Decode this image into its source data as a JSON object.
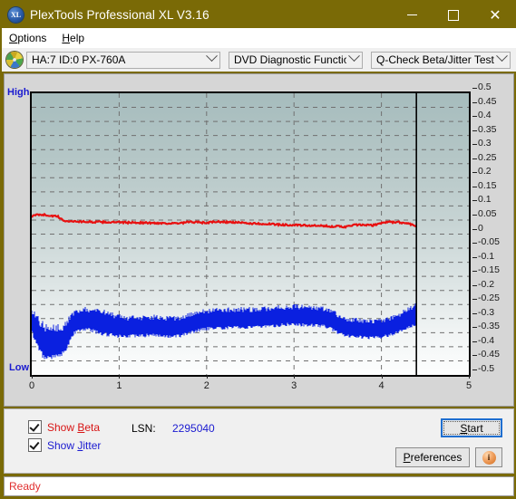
{
  "window": {
    "title": "PlexTools Professional XL V3.16",
    "icon": "xl-logo-icon",
    "minimize": "minimize-icon",
    "maximize": "maximize-icon",
    "close": "close-icon"
  },
  "menu": {
    "items": [
      {
        "label": "Options",
        "accel": "O"
      },
      {
        "label": "Help",
        "accel": "H"
      }
    ]
  },
  "toolbar": {
    "drive_icon": "optical-disc-icon",
    "drive_select": {
      "value": "HA:7 ID:0  PX-760A"
    },
    "function_select": {
      "value": "DVD Diagnostic Functions"
    },
    "test_select": {
      "value": "Q-Check Beta/Jitter Test"
    }
  },
  "chart_labels": {
    "high": "High",
    "low": "Low"
  },
  "controls": {
    "show_beta": {
      "label": "Show Beta",
      "accel": "B",
      "checked": true,
      "color": "#d81515"
    },
    "show_jitter": {
      "label": "Show Jitter",
      "accel": "J",
      "checked": true,
      "color": "#1a1ad0"
    },
    "lsn_label": "LSN:",
    "lsn_value": "2295040",
    "start_button": {
      "label": "Start",
      "accel": "S"
    },
    "preferences_button": {
      "label": "Preferences",
      "accel": "P"
    },
    "info_button": {
      "icon": "info-icon"
    }
  },
  "status": {
    "text": "Ready"
  },
  "chart_data": {
    "type": "line",
    "title": "Q-Check Beta/Jitter Test",
    "xlabel": "",
    "ylabel": "",
    "xlim": [
      0,
      5
    ],
    "ylim": [
      -0.5,
      0.5
    ],
    "xticks": [
      0,
      1,
      2,
      3,
      4,
      5
    ],
    "yticks": [
      0.5,
      0.45,
      0.4,
      0.35,
      0.3,
      0.25,
      0.2,
      0.15,
      0.1,
      0.05,
      0,
      -0.05,
      -0.1,
      -0.15,
      -0.2,
      -0.25,
      -0.3,
      -0.35,
      -0.4,
      -0.45,
      -0.5
    ],
    "grid": true,
    "grid_style": "dashed",
    "legend": [
      "Show Beta",
      "Show Jitter"
    ],
    "annotations": [
      {
        "type": "vline",
        "x": 4.4,
        "color": "#000000",
        "label": "scan-end-marker"
      }
    ],
    "data_end_x": 4.4,
    "series": [
      {
        "name": "Beta",
        "color": "#e81010",
        "type": "line",
        "x": [
          0.0,
          0.05,
          0.1,
          0.15,
          0.2,
          0.25,
          0.3,
          0.35,
          0.4,
          0.5,
          0.6,
          0.7,
          0.8,
          0.9,
          1.0,
          1.1,
          1.2,
          1.3,
          1.4,
          1.5,
          1.6,
          1.7,
          1.8,
          1.9,
          2.0,
          2.1,
          2.2,
          2.3,
          2.4,
          2.5,
          2.6,
          2.7,
          2.8,
          2.9,
          3.0,
          3.1,
          3.2,
          3.3,
          3.4,
          3.5,
          3.6,
          3.7,
          3.8,
          3.9,
          4.0,
          4.1,
          4.2,
          4.3,
          4.4
        ],
        "y": [
          0.062,
          0.068,
          0.07,
          0.068,
          0.066,
          0.064,
          0.062,
          0.05,
          0.046,
          0.045,
          0.044,
          0.043,
          0.043,
          0.042,
          0.042,
          0.041,
          0.041,
          0.04,
          0.039,
          0.039,
          0.038,
          0.038,
          0.043,
          0.042,
          0.04,
          0.044,
          0.043,
          0.042,
          0.04,
          0.038,
          0.037,
          0.036,
          0.034,
          0.033,
          0.032,
          0.031,
          0.03,
          0.029,
          0.028,
          0.027,
          0.026,
          0.033,
          0.032,
          0.031,
          0.04,
          0.043,
          0.042,
          0.038,
          0.03
        ]
      },
      {
        "name": "Jitter",
        "color": "#0a20e0",
        "type": "band",
        "x": [
          0.0,
          0.05,
          0.1,
          0.15,
          0.2,
          0.25,
          0.3,
          0.35,
          0.4,
          0.45,
          0.5,
          0.55,
          0.6,
          0.7,
          0.8,
          0.9,
          1.0,
          1.1,
          1.2,
          1.3,
          1.4,
          1.5,
          1.6,
          1.7,
          1.8,
          1.9,
          2.0,
          2.1,
          2.2,
          2.3,
          2.4,
          2.5,
          2.6,
          2.7,
          2.8,
          2.9,
          3.0,
          3.1,
          3.2,
          3.3,
          3.4,
          3.5,
          3.6,
          3.7,
          3.8,
          3.9,
          4.0,
          4.1,
          4.2,
          4.3,
          4.4
        ],
        "y_mid": [
          -0.312,
          -0.34,
          -0.37,
          -0.388,
          -0.392,
          -0.386,
          -0.384,
          -0.38,
          -0.36,
          -0.33,
          -0.312,
          -0.306,
          -0.304,
          -0.308,
          -0.316,
          -0.324,
          -0.33,
          -0.332,
          -0.33,
          -0.33,
          -0.328,
          -0.33,
          -0.334,
          -0.33,
          -0.32,
          -0.312,
          -0.306,
          -0.304,
          -0.302,
          -0.302,
          -0.3,
          -0.3,
          -0.3,
          -0.298,
          -0.294,
          -0.292,
          -0.29,
          -0.292,
          -0.294,
          -0.296,
          -0.3,
          -0.32,
          -0.334,
          -0.336,
          -0.338,
          -0.34,
          -0.338,
          -0.33,
          -0.318,
          -0.3,
          -0.288
        ],
        "y_halfwidth": [
          0.028,
          0.035,
          0.04,
          0.042,
          0.04,
          0.038,
          0.038,
          0.036,
          0.034,
          0.03,
          0.028,
          0.026,
          0.026,
          0.028,
          0.03,
          0.028,
          0.026,
          0.024,
          0.024,
          0.024,
          0.024,
          0.024,
          0.024,
          0.024,
          0.024,
          0.024,
          0.024,
          0.024,
          0.024,
          0.024,
          0.024,
          0.024,
          0.024,
          0.024,
          0.024,
          0.024,
          0.024,
          0.024,
          0.024,
          0.024,
          0.024,
          0.024,
          0.022,
          0.022,
          0.022,
          0.022,
          0.022,
          0.022,
          0.022,
          0.024,
          0.026
        ]
      }
    ]
  }
}
